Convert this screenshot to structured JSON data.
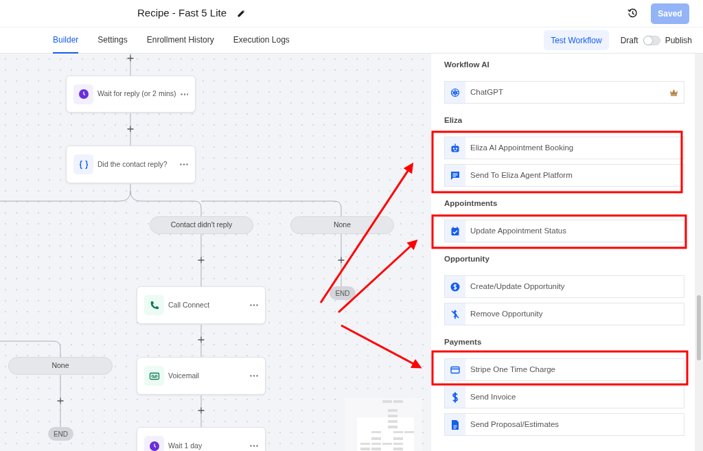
{
  "header": {
    "title": "Recipe - Fast 5 Lite",
    "save_button": {
      "label": "Saved",
      "disabled": true
    }
  },
  "tabs": [
    {
      "label": "Builder",
      "selected": true
    },
    {
      "label": "Settings",
      "selected": false
    },
    {
      "label": "Enrollment History",
      "selected": false
    },
    {
      "label": "Execution Logs",
      "selected": false
    }
  ],
  "test_button": "Test Workflow",
  "publish_toggle": {
    "off_label": "Draft",
    "on_label": "Publish",
    "on": false
  },
  "nodes": [
    {
      "kind": "step",
      "label": "Wait for reply (or 2 mins)"
    },
    {
      "kind": "step",
      "label": "Did the contact reply?"
    },
    {
      "kind": "branch",
      "label": "Contact didn't reply"
    },
    {
      "kind": "branch",
      "label": "None"
    },
    {
      "kind": "step",
      "label": "Call Connect"
    },
    {
      "kind": "end",
      "label": "END"
    },
    {
      "kind": "branch",
      "label": "None"
    },
    {
      "kind": "step",
      "label": "Voicemail"
    },
    {
      "kind": "end",
      "label": "END"
    },
    {
      "kind": "step",
      "label": "Wait 1 day"
    }
  ],
  "panel": {
    "sections": [
      {
        "title": "Workflow AI",
        "items": [
          {
            "label": "ChatGPT",
            "premium": true
          }
        ]
      },
      {
        "title": "Eliza",
        "items": [
          {
            "label": "Eliza AI Appointment Booking",
            "premium": false
          },
          {
            "label": "Send To Eliza Agent Platform",
            "premium": false
          }
        ]
      },
      {
        "title": "Appointments",
        "items": [
          {
            "label": "Update Appointment Status",
            "premium": false
          }
        ]
      },
      {
        "title": "Opportunity",
        "items": [
          {
            "label": "Create/Update Opportunity",
            "premium": false
          },
          {
            "label": "Remove Opportunity",
            "premium": false
          }
        ]
      },
      {
        "title": "Payments",
        "items": [
          {
            "label": "Stripe One Time Charge",
            "premium": false
          },
          {
            "label": "Send Invoice",
            "premium": false
          },
          {
            "label": "Send Proposal/Estimates",
            "premium": false
          }
        ]
      }
    ]
  }
}
